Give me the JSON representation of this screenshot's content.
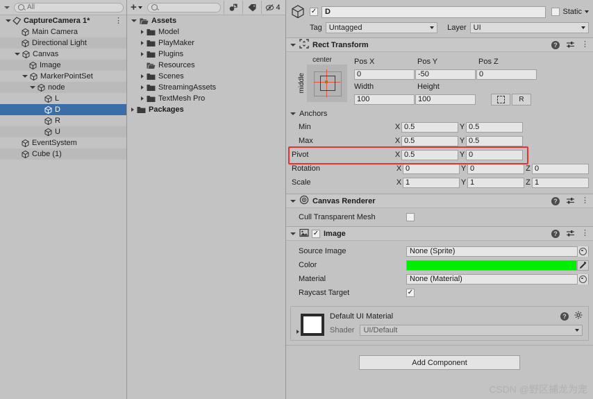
{
  "hierarchy": {
    "search_placeholder": "All",
    "scene_name": "CaptureCamera 1*",
    "items": [
      {
        "label": "Main Camera",
        "depth": 2,
        "icon": "cube-icon",
        "expandable": false,
        "selected": false
      },
      {
        "label": "Directional Light",
        "depth": 2,
        "icon": "cube-icon",
        "expandable": false,
        "selected": false
      },
      {
        "label": "Canvas",
        "depth": 2,
        "icon": "cube-icon",
        "expandable": true,
        "selected": false
      },
      {
        "label": "Image",
        "depth": 3,
        "icon": "cube-icon",
        "expandable": false,
        "selected": false
      },
      {
        "label": "MarkerPointSet",
        "depth": 3,
        "icon": "cube-icon",
        "expandable": true,
        "selected": false
      },
      {
        "label": "node",
        "depth": 4,
        "icon": "cube-icon",
        "expandable": true,
        "selected": false
      },
      {
        "label": "L",
        "depth": 5,
        "icon": "cube-icon",
        "expandable": false,
        "selected": false
      },
      {
        "label": "D",
        "depth": 5,
        "icon": "cube-icon",
        "expandable": false,
        "selected": true
      },
      {
        "label": "R",
        "depth": 5,
        "icon": "cube-icon",
        "expandable": false,
        "selected": false
      },
      {
        "label": "U",
        "depth": 5,
        "icon": "cube-icon",
        "expandable": false,
        "selected": false
      },
      {
        "label": "EventSystem",
        "depth": 2,
        "icon": "cube-icon",
        "expandable": false,
        "selected": false
      },
      {
        "label": "Cube (1)",
        "depth": 2,
        "icon": "cube-icon",
        "expandable": false,
        "selected": false
      }
    ]
  },
  "project": {
    "search_placeholder": "",
    "add_label": "+",
    "hidden_count": "4",
    "items": [
      {
        "label": "Assets",
        "depth": 0,
        "expandable": true,
        "expanded": true,
        "bold": true,
        "folder": "open"
      },
      {
        "label": "Model",
        "depth": 1,
        "expandable": true,
        "expanded": false,
        "bold": false,
        "folder": "closed"
      },
      {
        "label": "PlayMaker",
        "depth": 1,
        "expandable": true,
        "expanded": false,
        "bold": false,
        "folder": "closed"
      },
      {
        "label": "Plugins",
        "depth": 1,
        "expandable": true,
        "expanded": false,
        "bold": false,
        "folder": "closed"
      },
      {
        "label": "Resources",
        "depth": 1,
        "expandable": false,
        "expanded": false,
        "bold": false,
        "folder": "open"
      },
      {
        "label": "Scenes",
        "depth": 1,
        "expandable": true,
        "expanded": false,
        "bold": false,
        "folder": "closed"
      },
      {
        "label": "StreamingAssets",
        "depth": 1,
        "expandable": true,
        "expanded": false,
        "bold": false,
        "folder": "closed"
      },
      {
        "label": "TextMesh Pro",
        "depth": 1,
        "expandable": true,
        "expanded": false,
        "bold": false,
        "folder": "closed"
      },
      {
        "label": "Packages",
        "depth": 0,
        "expandable": true,
        "expanded": false,
        "bold": true,
        "folder": "closed"
      }
    ]
  },
  "inspector": {
    "object_name": "D",
    "object_enabled": true,
    "static_label": "Static",
    "static_checked": false,
    "tag_label": "Tag",
    "tag_value": "Untagged",
    "layer_label": "Layer",
    "layer_value": "UI",
    "rect_transform": {
      "title": "Rect Transform",
      "anchor_preset_top": "center",
      "anchor_preset_left": "middle",
      "pos_x_label": "Pos X",
      "pos_y_label": "Pos Y",
      "pos_z_label": "Pos Z",
      "pos_x": "0",
      "pos_y": "-50",
      "pos_z": "0",
      "width_label": "Width",
      "height_label": "Height",
      "width": "100",
      "height": "100",
      "blueprint_label": "",
      "raw_label": "R",
      "anchors_label": "Anchors",
      "min_label": "Min",
      "min_x": "0.5",
      "min_y": "0.5",
      "max_label": "Max",
      "max_x": "0.5",
      "max_y": "0.5",
      "pivot_label": "Pivot",
      "pivot_x": "0.5",
      "pivot_y": "0",
      "rotation_label": "Rotation",
      "rot_x": "0",
      "rot_y": "0",
      "rot_z": "0",
      "scale_label": "Scale",
      "scale_x": "1",
      "scale_y": "1",
      "scale_z": "1",
      "axis_x": "X",
      "axis_y": "Y",
      "axis_z": "Z"
    },
    "canvas_renderer": {
      "title": "Canvas Renderer",
      "cull_label": "Cull Transparent Mesh",
      "cull_checked": false
    },
    "image": {
      "title": "Image",
      "enabled": true,
      "source_label": "Source Image",
      "source_value": "None (Sprite)",
      "color_label": "Color",
      "color_value": "#00EE00",
      "material_label": "Material",
      "material_value": "None (Material)",
      "raycast_label": "Raycast Target",
      "raycast_checked": true
    },
    "material_preview": {
      "name": "Default UI Material",
      "shader_label": "Shader",
      "shader_value": "UI/Default"
    },
    "add_component_label": "Add Component"
  },
  "watermark": "CSDN @野区捕龙为宠",
  "colors": {
    "selection_blue": "#3a6ea8",
    "highlight_red": "#ec2f2f",
    "image_color": "#00EE00",
    "panel_bg": "#c3c3c3"
  }
}
